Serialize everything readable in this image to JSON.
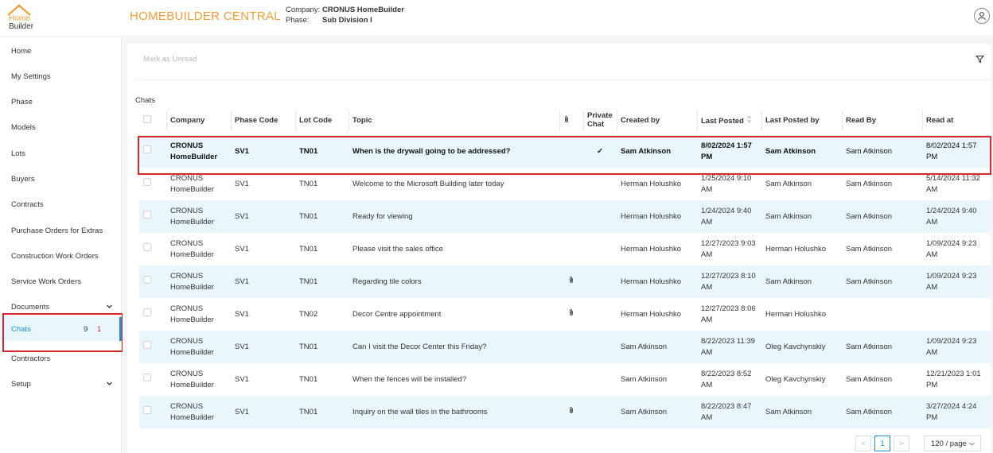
{
  "header": {
    "logo_line1": "Home",
    "logo_line2": "Builder",
    "app_title": "HOMEBUILDER CENTRAL",
    "company_label": "Company:",
    "company_value": "CRONUS HomeBuilder",
    "phase_label": "Phase:",
    "phase_value": "Sub Division I",
    "user_icon": "user-icon"
  },
  "sidebar": {
    "items": [
      {
        "label": "Home"
      },
      {
        "label": "My Settings"
      },
      {
        "label": "Phase"
      },
      {
        "label": "Models"
      },
      {
        "label": "Lots"
      },
      {
        "label": "Buyers"
      },
      {
        "label": "Contracts"
      },
      {
        "label": "Purchase Orders for Extras"
      },
      {
        "label": "Construction Work Orders"
      },
      {
        "label": "Service Work Orders"
      },
      {
        "label": "Documents"
      },
      {
        "label": "Chats",
        "count": "9",
        "unread": "1"
      },
      {
        "label": "Contractors"
      },
      {
        "label": "Setup"
      }
    ]
  },
  "toolbar": {
    "mark_unread": "Mark as Unread",
    "filter_icon": "filter-icon"
  },
  "table": {
    "caption": "Chats",
    "headers": {
      "company": "Company",
      "phase_code": "Phase Code",
      "lot_code": "Lot Code",
      "topic": "Topic",
      "attachment_icon": "paperclip-icon",
      "private_chat": "Private Chat",
      "created_by": "Created by",
      "last_posted": "Last Posted",
      "last_posted_by": "Last Posted by",
      "read_by": "Read By",
      "read_at": "Read at"
    },
    "rows": [
      {
        "company": "CRONUS HomeBuilder",
        "phase": "SV1",
        "lot": "TN01",
        "topic": "When is the drywall going to be addressed?",
        "attach": "",
        "private": "✓",
        "created_by": "Sam Atkinson",
        "last_posted": "8/02/2024 1:57 PM",
        "last_posted_by": "Sam Atkinson",
        "read_by": "Sam Atkinson",
        "read_at": "8/02/2024 1:57 PM"
      },
      {
        "company": "CRONUS HomeBuilder",
        "phase": "SV1",
        "lot": "TN01",
        "topic": "Welcome to the Microsoft Building later today",
        "attach": "",
        "private": "",
        "created_by": "Herman Holushko",
        "last_posted": "1/25/2024 9:10 AM",
        "last_posted_by": "Sam Atkinson",
        "read_by": "Sam Atkinson",
        "read_at": "5/14/2024 11:32 AM"
      },
      {
        "company": "CRONUS HomeBuilder",
        "phase": "SV1",
        "lot": "TN01",
        "topic": "Ready for viewing",
        "attach": "",
        "private": "",
        "created_by": "Herman Holushko",
        "last_posted": "1/24/2024 9:40 AM",
        "last_posted_by": "Sam Atkinson",
        "read_by": "Sam Atkinson",
        "read_at": "1/24/2024 9:40 AM"
      },
      {
        "company": "CRONUS HomeBuilder",
        "phase": "SV1",
        "lot": "TN01",
        "topic": "Please visit the sales office",
        "attach": "",
        "private": "",
        "created_by": "Herman Holushko",
        "last_posted": "12/27/2023 9:03 AM",
        "last_posted_by": "Herman Holushko",
        "read_by": "Sam Atkinson",
        "read_at": "1/09/2024 9:23 AM"
      },
      {
        "company": "CRONUS HomeBuilder",
        "phase": "SV1",
        "lot": "TN01",
        "topic": "Regarding tile colors",
        "attach": "paperclip",
        "private": "",
        "created_by": "Herman Holushko",
        "last_posted": "12/27/2023 8:10 AM",
        "last_posted_by": "Sam Atkinson",
        "read_by": "Sam Atkinson",
        "read_at": "1/09/2024 9:23 AM"
      },
      {
        "company": "CRONUS HomeBuilder",
        "phase": "SV1",
        "lot": "TN02",
        "topic": "Decor Centre appointment",
        "attach": "paperclip",
        "private": "",
        "created_by": "Herman Holushko",
        "last_posted": "12/27/2023 8:06 AM",
        "last_posted_by": "Herman Holushko",
        "read_by": "",
        "read_at": ""
      },
      {
        "company": "CRONUS HomeBuilder",
        "phase": "SV1",
        "lot": "TN01",
        "topic": "Can I visit the Decor Center this Friday?",
        "attach": "",
        "private": "",
        "created_by": "Sam Atkinson",
        "last_posted": "8/22/2023 11:39 AM",
        "last_posted_by": "Oleg Kavchynskiy",
        "read_by": "Sam Atkinson",
        "read_at": "1/09/2024 9:23 AM"
      },
      {
        "company": "CRONUS HomeBuilder",
        "phase": "SV1",
        "lot": "TN01",
        "topic": "When the fences will be installed?",
        "attach": "",
        "private": "",
        "created_by": "Sam Atkinson",
        "last_posted": "8/22/2023 8:52 AM",
        "last_posted_by": "Oleg Kavchynskiy",
        "read_by": "Sam Atkinson",
        "read_at": "12/21/2023 1:01 PM"
      },
      {
        "company": "CRONUS HomeBuilder",
        "phase": "SV1",
        "lot": "TN01",
        "topic": "Inquiry on the wall tiles in the bathrooms",
        "attach": "paperclip",
        "private": "",
        "created_by": "Sam Atkinson",
        "last_posted": "8/22/2023 8:47 AM",
        "last_posted_by": "Sam Atkinson",
        "read_by": "Sam Atkinson",
        "read_at": "3/27/2024 4:24 PM"
      }
    ]
  },
  "pagination": {
    "prev": "<",
    "current_page": "1",
    "next": ">",
    "page_size": "120 / page"
  },
  "colors": {
    "accent_orange": "#f39c36",
    "link_blue": "#1a8fd6",
    "row_highlight": "#e9f6fc",
    "annotation_red": "#d9262a"
  }
}
